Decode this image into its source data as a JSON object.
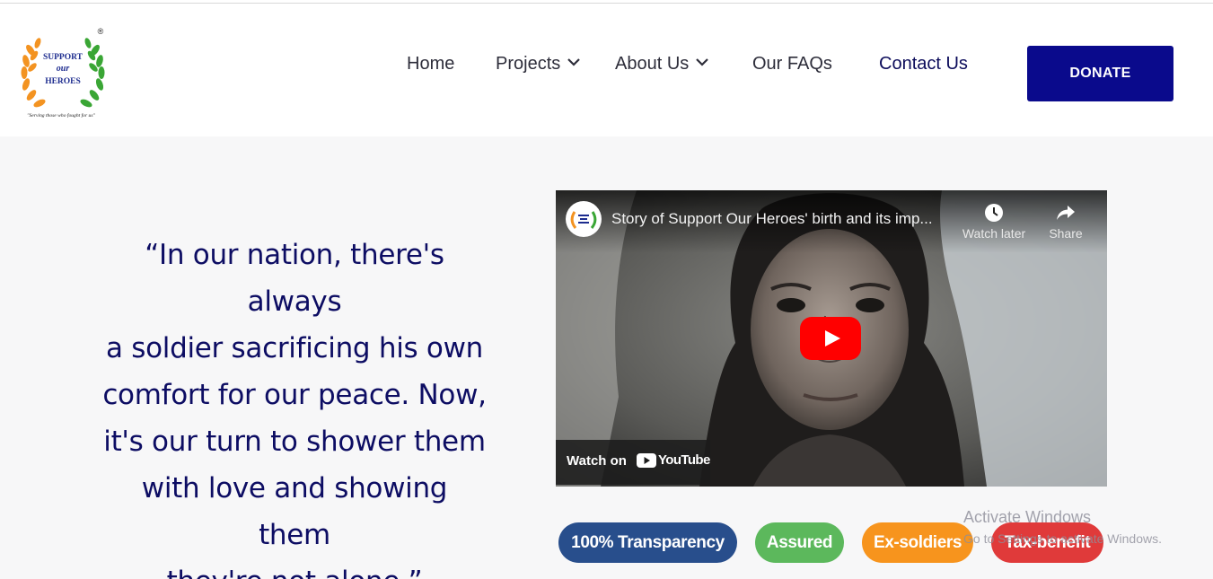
{
  "logo": {
    "text_line1": "SUPPORT",
    "text_line2": "our",
    "text_line3": "HEROES",
    "tagline": "\"Serving those who fought for us\"",
    "registered_mark": "®",
    "colors": {
      "laurel_left": "#f39321",
      "laurel_right": "#3aa635",
      "text": "#1d2c8f"
    }
  },
  "nav": {
    "items": [
      {
        "label": "Home",
        "has_dropdown": false
      },
      {
        "label": "Projects",
        "has_dropdown": true,
        "icon": "chevron-down-icon"
      },
      {
        "label": "About Us",
        "has_dropdown": true,
        "icon": "chevron-down-icon"
      },
      {
        "label": "Our FAQs",
        "has_dropdown": false
      },
      {
        "label": "Contact Us",
        "has_dropdown": false
      }
    ],
    "donate_label": "DONATE",
    "donate_color": "#0a0a8c"
  },
  "hero": {
    "quote_lines": [
      "“In our nation, there's always",
      "a soldier sacrificing his own",
      "comfort for our peace. Now,",
      "it's our turn to shower them",
      "with love and showing them",
      "they're not alone.”"
    ],
    "quote_color": "#0d0d63"
  },
  "video": {
    "title": "Story of Support Our Heroes' birth and its imp...",
    "watch_later_label": "Watch later",
    "share_label": "Share",
    "watch_on_label": "Watch on",
    "youtube_label": "YouTube",
    "icons": [
      "clock-icon",
      "share-arrow-icon",
      "play-icon",
      "youtube-logo-icon"
    ]
  },
  "badges": [
    {
      "label": "100% Transparency",
      "color": "#284e8c"
    },
    {
      "label": "Assured",
      "color": "#5cb85c"
    },
    {
      "label": "Ex-soldiers",
      "color": "#f7941d"
    },
    {
      "label": "Tax-benefit",
      "color": "#e03a3a"
    }
  ],
  "os_watermark": {
    "line1": "Activate Windows",
    "line2": "Go to Settings to activate Windows."
  }
}
